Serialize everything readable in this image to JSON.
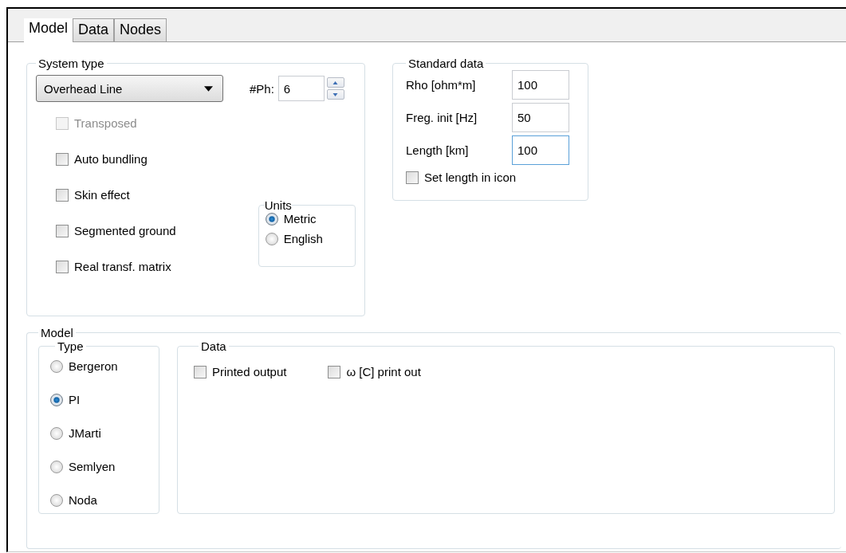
{
  "tabs": [
    {
      "label": "Model",
      "selected": true
    },
    {
      "label": "Data",
      "selected": false
    },
    {
      "label": "Nodes",
      "selected": false
    }
  ],
  "system_type": {
    "title": "System type",
    "dropdown": {
      "value": "Overhead Line"
    },
    "phases": {
      "label": "#Ph:",
      "value": "6"
    },
    "options": [
      {
        "label": "Transposed",
        "checked": false,
        "disabled": true
      },
      {
        "label": "Auto bundling",
        "checked": false,
        "disabled": false
      },
      {
        "label": "Skin effect",
        "checked": false,
        "disabled": false
      },
      {
        "label": "Segmented ground",
        "checked": false,
        "disabled": false
      },
      {
        "label": "Real transf. matrix",
        "checked": false,
        "disabled": false
      }
    ],
    "units": {
      "title": "Units",
      "options": [
        {
          "label": "Metric",
          "selected": true
        },
        {
          "label": "English",
          "selected": false
        }
      ]
    }
  },
  "standard_data": {
    "title": "Standard data",
    "fields": [
      {
        "label": "Rho [ohm*m]",
        "value": "100",
        "focused": false
      },
      {
        "label": "Freg. init [Hz]",
        "value": "50",
        "focused": false
      },
      {
        "label": "Length [km]",
        "value": "100",
        "focused": true
      }
    ],
    "set_length_in_icon": {
      "label": "Set length in icon",
      "checked": false
    }
  },
  "model": {
    "title": "Model",
    "type": {
      "title": "Type",
      "options": [
        {
          "label": "Bergeron",
          "selected": false
        },
        {
          "label": "PI",
          "selected": true
        },
        {
          "label": "JMarti",
          "selected": false
        },
        {
          "label": "Semlyen",
          "selected": false
        },
        {
          "label": "Noda",
          "selected": false
        }
      ]
    },
    "data": {
      "title": "Data",
      "options": [
        {
          "label": "Printed output",
          "checked": false
        },
        {
          "label": "ω [C] print out",
          "checked": false
        }
      ]
    }
  }
}
